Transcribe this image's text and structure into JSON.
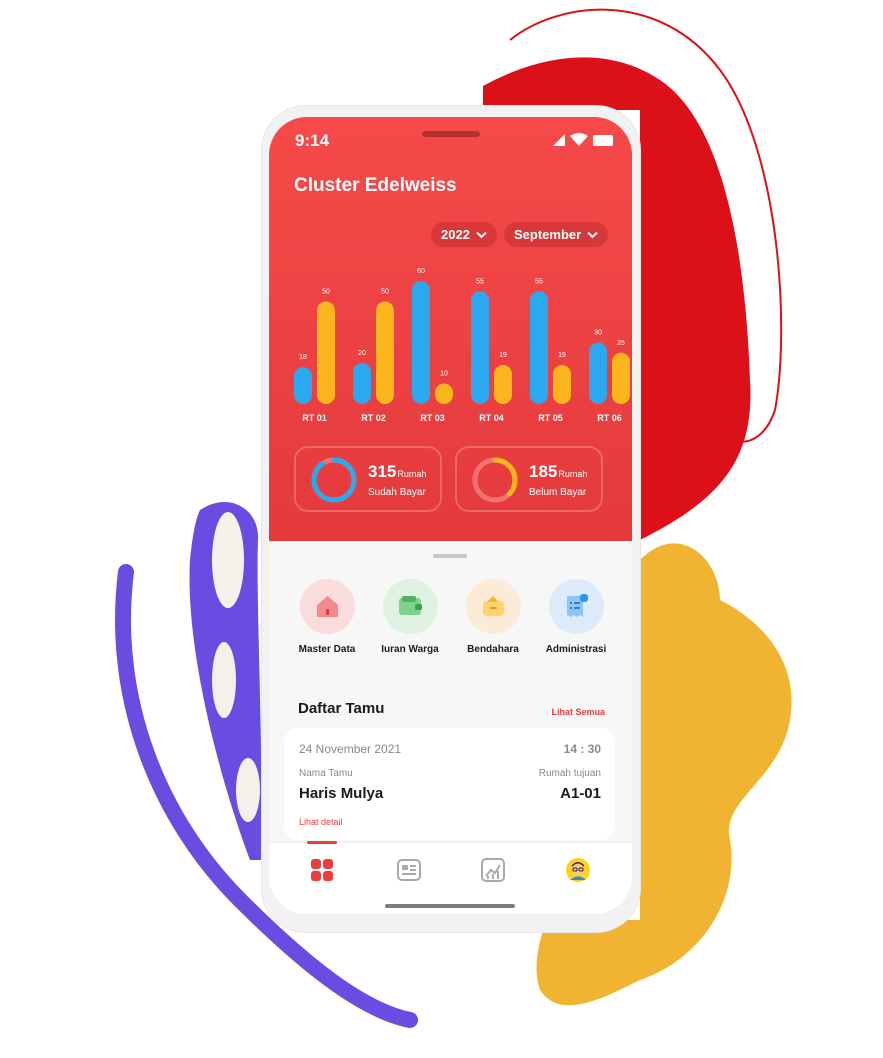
{
  "status": {
    "time": "9:14"
  },
  "header": {
    "title": "Cluster Edelweiss"
  },
  "filters": {
    "year": "2022",
    "month": "September"
  },
  "colors": {
    "primary": "#f04444",
    "blue": "#2ba8ee",
    "yellow": "#fbb51d"
  },
  "chart_data": {
    "type": "bar",
    "categories": [
      "RT 01",
      "RT 02",
      "RT 03",
      "RT 04",
      "RT 05",
      "RT 06"
    ],
    "series": [
      {
        "values": [
          18,
          20,
          60,
          55,
          55,
          30
        ],
        "color": "#2ba8ee"
      },
      {
        "values": [
          50,
          50,
          10,
          19,
          19,
          25
        ],
        "color": "#fbb51d"
      }
    ],
    "title": "",
    "xlabel": "",
    "ylabel": "",
    "ylim": [
      0,
      60
    ],
    "grid": false
  },
  "summary": [
    {
      "count": "315",
      "unit": "Rumah",
      "label": "Sudah Bayar",
      "fraction": 0.9,
      "color": "#2ba8ee"
    },
    {
      "count": "185",
      "unit": "Rumah",
      "label": "Belum Bayar",
      "fraction": 0.37,
      "color": "#fbb51d"
    }
  ],
  "menu": [
    {
      "label": "Master Data",
      "icon": "house-icon",
      "bg": "#fbdcdc"
    },
    {
      "label": "Iuran Warga",
      "icon": "wallet-icon",
      "bg": "#dff2e2"
    },
    {
      "label": "Bendahara",
      "icon": "money-box-icon",
      "bg": "#fcecd7"
    },
    {
      "label": "Administrasi",
      "icon": "receipt-icon",
      "bg": "#dcebf9"
    }
  ],
  "guests": {
    "title": "Daftar Tamu",
    "see_all": "Lihat Semua",
    "item": {
      "date": "24 November 2021",
      "time": "14 : 30",
      "name_label": "Nama Tamu",
      "name": "Haris Mulya",
      "house_label": "Rumah tujuan",
      "house": "A1-01",
      "detail": "Lihat detail"
    }
  },
  "tabs": [
    {
      "icon": "grid-icon",
      "active": true
    },
    {
      "icon": "list-icon",
      "active": false
    },
    {
      "icon": "chart-icon",
      "active": false
    },
    {
      "icon": "avatar-icon",
      "active": false
    }
  ]
}
